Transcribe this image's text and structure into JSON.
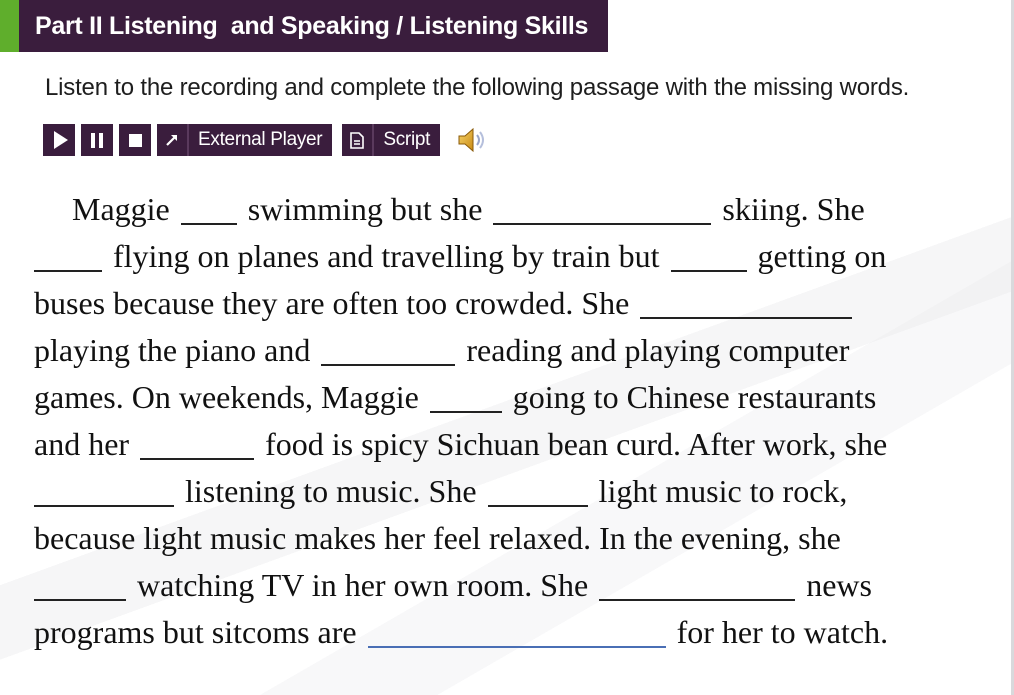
{
  "header": {
    "title": "Part II Listening  and Speaking / Listening Skills",
    "accent_color": "#5fae2c",
    "bar_color": "#3a1d3d"
  },
  "instruction": "Listen to the recording and complete the following passage with the missing words.",
  "toolbar": {
    "play_icon": "play-icon",
    "pause_icon": "pause-icon",
    "stop_icon": "stop-icon",
    "external_player_label": "External Player",
    "script_label": "Script",
    "speaker_icon": "speaker-icon"
  },
  "passage": {
    "lines": [
      [
        "Maggie ",
        " swimming but she ",
        " skiing. She"
      ],
      [
        "",
        " flying on planes and travelling by train but ",
        " getting on"
      ],
      [
        "buses because they are often too crowded. She ",
        ""
      ],
      [
        "playing the piano and ",
        " reading and playing computer"
      ],
      [
        "games. On weekends, Maggie ",
        " going to Chinese restaurants"
      ],
      [
        "and her ",
        " food is spicy Sichuan bean curd. After work, she"
      ],
      [
        "",
        " listening to music. She ",
        " light music to rock,"
      ],
      [
        "because light music makes her feel relaxed. In the evening, she"
      ],
      [
        "",
        " watching TV in her own room. She ",
        " news"
      ],
      [
        "programs but sitcoms are ",
        " for her to watch."
      ]
    ]
  }
}
